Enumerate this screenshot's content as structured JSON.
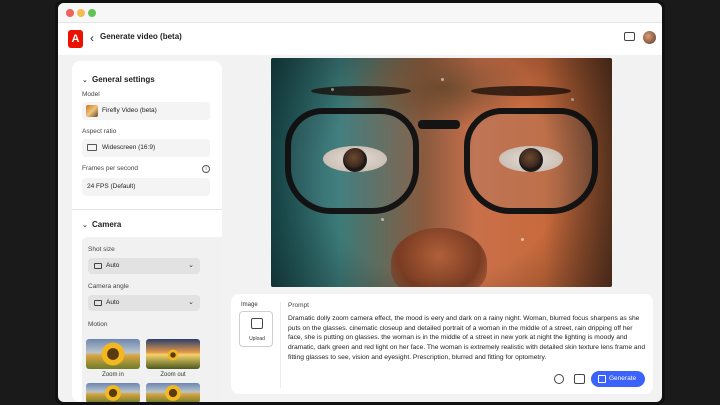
{
  "app": {
    "logo": "A",
    "title": "Generate video (beta)"
  },
  "sidebar": {
    "general_settings": {
      "heading": "General settings",
      "model_label": "Model",
      "model_value": "Firefly Video (beta)",
      "aspect_label": "Aspect ratio",
      "aspect_value": "Widescreen (16:9)",
      "fps_label": "Frames per second",
      "fps_value": "24 FPS (Default)",
      "info_glyph": "i"
    },
    "camera": {
      "heading": "Camera",
      "shot_size_label": "Shot size",
      "shot_size_value": "Auto",
      "camera_angle_label": "Camera angle",
      "camera_angle_value": "Auto",
      "motion_label": "Motion",
      "motion_options": [
        {
          "label": "Zoom in"
        },
        {
          "label": "Zoom out"
        }
      ]
    }
  },
  "prompt_panel": {
    "image_label": "Image",
    "upload_label": "Upload",
    "prompt_label": "Prompt",
    "prompt_text": "Dramatic dolly zoom camera effect, the mood is eery and dark on a rainy night. Woman, blurred focus sharpens as she puts on the glasses. cinematic closeup and detailed portrait of a woman in the middle of a street, rain dripping off her face, she is putting on glasses. the woman is in the middle of a street in new york at night the lighting is moody and dramatic, dark green and red light on her face. The woman is extremely realistic with detailed skin texture lens frame and fitting glasses to see, vision and eyesight. Prescription, blurred and fitting for optometry.",
    "generate_label": "Generate"
  },
  "icons": {
    "back": "chevron-left-icon",
    "feedback": "feedback-icon",
    "history": "history-icon",
    "settings": "sliders-icon"
  },
  "colors": {
    "accent": "#3b63fb",
    "brand": "#eb1000"
  }
}
